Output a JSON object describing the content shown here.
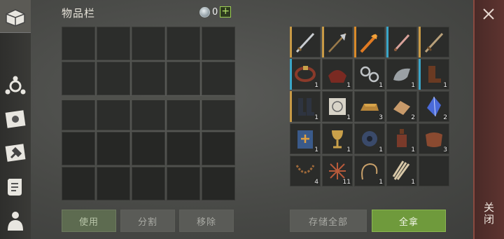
{
  "inventory": {
    "title": "物品栏",
    "currency_amount": "0",
    "currency_add": "+"
  },
  "buttons": {
    "use": "使用",
    "split": "分割",
    "move": "移除",
    "store_all": "存储全部",
    "take_all": "全拿",
    "close": "关闭"
  },
  "loot_items": [
    {
      "icon": "sword-icon",
      "strip": "#c89a46",
      "qty": ""
    },
    {
      "icon": "halberd-icon",
      "strip": "#c89a46",
      "qty": ""
    },
    {
      "icon": "flame-blade-icon",
      "strip": "#d98a2a",
      "qty": ""
    },
    {
      "icon": "dagger-icon",
      "strip": "#3aa6c8",
      "qty": ""
    },
    {
      "icon": "longsword-icon",
      "strip": "#c89a46",
      "qty": ""
    },
    {
      "icon": "belt-icon",
      "strip": "#3aa6c8",
      "qty": "1"
    },
    {
      "icon": "saddle-icon",
      "strip": "",
      "qty": "1"
    },
    {
      "icon": "chain-icon",
      "strip": "",
      "qty": "1"
    },
    {
      "icon": "gauntlet-icon",
      "strip": "",
      "qty": "1"
    },
    {
      "icon": "boots-icon",
      "strip": "#3aa6c8",
      "qty": "1"
    },
    {
      "icon": "greaves-icon",
      "strip": "#c89a46",
      "qty": "1"
    },
    {
      "icon": "blueprint-icon",
      "strip": "",
      "qty": "1"
    },
    {
      "icon": "ingot-icon",
      "strip": "",
      "qty": "3"
    },
    {
      "icon": "wood-chips-icon",
      "strip": "",
      "qty": "2"
    },
    {
      "icon": "crystal-icon",
      "strip": "",
      "qty": "2"
    },
    {
      "icon": "book-icon",
      "strip": "",
      "qty": "1"
    },
    {
      "icon": "goblet-icon",
      "strip": "",
      "qty": "1"
    },
    {
      "icon": "gear-part-icon",
      "strip": "",
      "qty": "1"
    },
    {
      "icon": "bottle-icon",
      "strip": "",
      "qty": "1"
    },
    {
      "icon": "leather-icon",
      "strip": "",
      "qty": "3"
    },
    {
      "icon": "rope-chain-icon",
      "strip": "",
      "qty": "4"
    },
    {
      "icon": "net-icon",
      "strip": "",
      "qty": "11"
    },
    {
      "icon": "whip-icon",
      "strip": "",
      "qty": "1"
    },
    {
      "icon": "scroll-bundle-icon",
      "strip": "",
      "qty": "1"
    }
  ]
}
